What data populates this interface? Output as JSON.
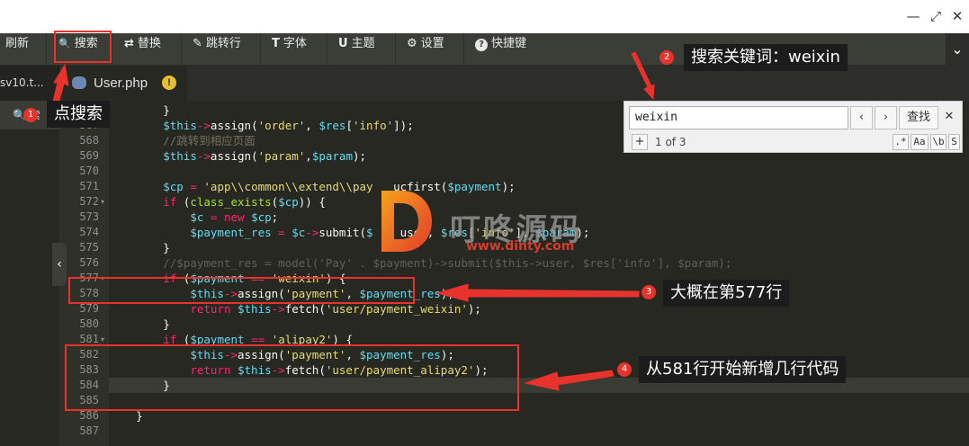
{
  "window": {
    "restore_glyph": "⤢",
    "close_glyph": "✕",
    "minimize_glyph": "—"
  },
  "toolbar": {
    "items": [
      {
        "icon": "refresh-icon",
        "glyph": "",
        "label": "刷新"
      },
      {
        "icon": "search-icon",
        "glyph": "🔍",
        "label": "搜索"
      },
      {
        "icon": "replace-icon",
        "glyph": "⇄",
        "label": "替换"
      },
      {
        "icon": "goto-icon",
        "glyph": "✎",
        "label": "跳转行"
      },
      {
        "icon": "font-icon",
        "glyph": "T",
        "label": "字体"
      },
      {
        "icon": "theme-icon",
        "glyph": "U",
        "label": "主题"
      },
      {
        "icon": "gear-icon",
        "glyph": "⚙",
        "label": "设置"
      },
      {
        "icon": "help-icon",
        "glyph": "?",
        "label": "快捷键"
      }
    ],
    "more_glyph": "⌄"
  },
  "tabs": {
    "left_tab": "sv10.t...",
    "active_tab": "User.php",
    "warn_glyph": "!"
  },
  "sidebar": {
    "search_label": "🔍 索"
  },
  "search_panel": {
    "query": "weixin",
    "prev_glyph": "‹",
    "next_glyph": "›",
    "find_label": "查找",
    "close_glyph": "✕",
    "add_glyph": "+",
    "count": "1 of 3",
    "options": [
      ".*",
      "Aa",
      "\\b",
      "S"
    ]
  },
  "editor": {
    "lines": [
      {
        "num": "",
        "tokens": [
          [
            "v",
            "        }"
          ]
        ]
      },
      {
        "num": "567",
        "tokens": [
          [
            "v",
            "        "
          ],
          [
            "p",
            "$this"
          ],
          [
            "k",
            "->"
          ],
          [
            "v",
            "assign("
          ],
          [
            "s",
            "'order'"
          ],
          [
            "v",
            ", "
          ],
          [
            "p",
            "$res"
          ],
          [
            "v",
            "["
          ],
          [
            "s",
            "'info'"
          ],
          [
            "v",
            "]);"
          ]
        ]
      },
      {
        "num": "568",
        "tokens": [
          [
            "c",
            "        //跳转到相应页面"
          ]
        ]
      },
      {
        "num": "569",
        "tokens": [
          [
            "v",
            "        "
          ],
          [
            "p",
            "$this"
          ],
          [
            "k",
            "->"
          ],
          [
            "v",
            "assign("
          ],
          [
            "s",
            "'param'"
          ],
          [
            "v",
            ","
          ],
          [
            "p",
            "$param"
          ],
          [
            "v",
            ");"
          ]
        ]
      },
      {
        "num": "570",
        "tokens": []
      },
      {
        "num": "571",
        "tokens": [
          [
            "v",
            "        "
          ],
          [
            "p",
            "$cp"
          ],
          [
            "v",
            " "
          ],
          [
            "k",
            "="
          ],
          [
            "v",
            " "
          ],
          [
            "s",
            "'app\\\\common\\\\extend\\\\pay"
          ],
          [
            "v",
            "   ucfirst("
          ],
          [
            "p",
            "$payment"
          ],
          [
            "v",
            ");"
          ]
        ]
      },
      {
        "num": "572",
        "fold": true,
        "tokens": [
          [
            "v",
            "        "
          ],
          [
            "k",
            "if"
          ],
          [
            "v",
            " ("
          ],
          [
            "f",
            "class_exists"
          ],
          [
            "v",
            "("
          ],
          [
            "p",
            "$cp"
          ],
          [
            "v",
            ")) {"
          ]
        ]
      },
      {
        "num": "573",
        "tokens": [
          [
            "v",
            "            "
          ],
          [
            "p",
            "$c"
          ],
          [
            "v",
            " "
          ],
          [
            "k",
            "="
          ],
          [
            "v",
            " "
          ],
          [
            "k",
            "new"
          ],
          [
            "v",
            " "
          ],
          [
            "p",
            "$cp"
          ],
          [
            "v",
            ";"
          ]
        ]
      },
      {
        "num": "574",
        "tokens": [
          [
            "v",
            "            "
          ],
          [
            "p",
            "$payment_res"
          ],
          [
            "v",
            " "
          ],
          [
            "k",
            "="
          ],
          [
            "v",
            " "
          ],
          [
            "p",
            "$c"
          ],
          [
            "k",
            "->"
          ],
          [
            "v",
            "submit("
          ],
          [
            "p",
            "$"
          ],
          [
            "v",
            "    user, "
          ],
          [
            "p",
            "$res"
          ],
          [
            "v",
            "["
          ],
          [
            "s",
            "'info'"
          ],
          [
            "v",
            "], "
          ],
          [
            "p",
            "$param"
          ],
          [
            "v",
            ");"
          ]
        ]
      },
      {
        "num": "575",
        "tokens": [
          [
            "v",
            "        }"
          ]
        ]
      },
      {
        "num": "576",
        "tokens": [
          [
            "dim",
            "        //$payment_res = model('Pay' . $payment)->submit($this->user, $res['info'], $param);"
          ]
        ]
      },
      {
        "num": "577",
        "fold": true,
        "tokens": [
          [
            "v",
            "        "
          ],
          [
            "k",
            "if"
          ],
          [
            "v",
            " ("
          ],
          [
            "p",
            "$payment"
          ],
          [
            "v",
            " "
          ],
          [
            "k",
            "=="
          ],
          [
            "v",
            " "
          ],
          [
            "s",
            "'weixin'"
          ],
          [
            "v",
            ") {"
          ]
        ]
      },
      {
        "num": "578",
        "tokens": [
          [
            "v",
            "            "
          ],
          [
            "p",
            "$this"
          ],
          [
            "k",
            "->"
          ],
          [
            "v",
            "assign("
          ],
          [
            "s",
            "'payment'"
          ],
          [
            "v",
            ", "
          ],
          [
            "p",
            "$payment_res"
          ],
          [
            "v",
            ");"
          ]
        ]
      },
      {
        "num": "579",
        "tokens": [
          [
            "v",
            "            "
          ],
          [
            "k",
            "return"
          ],
          [
            "v",
            " "
          ],
          [
            "p",
            "$this"
          ],
          [
            "k",
            "->"
          ],
          [
            "v",
            "fetch("
          ],
          [
            "s",
            "'user/payment_weixin'"
          ],
          [
            "v",
            ");"
          ]
        ]
      },
      {
        "num": "580",
        "tokens": [
          [
            "v",
            "        }"
          ]
        ]
      },
      {
        "num": "581",
        "fold": true,
        "tokens": [
          [
            "v",
            "        "
          ],
          [
            "k",
            "if"
          ],
          [
            "v",
            " ("
          ],
          [
            "p",
            "$payment"
          ],
          [
            "v",
            " "
          ],
          [
            "k",
            "=="
          ],
          [
            "v",
            " "
          ],
          [
            "s",
            "'alipay2'"
          ],
          [
            "v",
            ") {"
          ]
        ]
      },
      {
        "num": "582",
        "tokens": [
          [
            "v",
            "            "
          ],
          [
            "p",
            "$this"
          ],
          [
            "k",
            "->"
          ],
          [
            "v",
            "assign("
          ],
          [
            "s",
            "'payment'"
          ],
          [
            "v",
            ", "
          ],
          [
            "p",
            "$payment_res"
          ],
          [
            "v",
            ");"
          ]
        ]
      },
      {
        "num": "583",
        "tokens": [
          [
            "v",
            "            "
          ],
          [
            "k",
            "return"
          ],
          [
            "v",
            " "
          ],
          [
            "p",
            "$this"
          ],
          [
            "k",
            "->"
          ],
          [
            "v",
            "fetch("
          ],
          [
            "s",
            "'user/payment_alipay2'"
          ],
          [
            "v",
            ");"
          ]
        ]
      },
      {
        "num": "584",
        "active": true,
        "tokens": [
          [
            "v",
            "        }"
          ]
        ]
      },
      {
        "num": "585",
        "tokens": []
      },
      {
        "num": "586",
        "tokens": [
          [
            "v",
            "    }"
          ]
        ]
      },
      {
        "num": "587",
        "tokens": []
      }
    ]
  },
  "watermark": {
    "brand_cn": "叮咚源码",
    "url": "www.dinty.com"
  },
  "annotations": {
    "step1": {
      "num": "1",
      "text": "点搜索"
    },
    "step2": {
      "num": "2",
      "text": "搜索关键词：weixin"
    },
    "step3": {
      "num": "3",
      "text": "大概在第577行"
    },
    "step4": {
      "num": "4",
      "text": "从581行开始新增几行代码"
    }
  },
  "colors": {
    "accent_red": "#e8322c",
    "editor_bg": "#272822",
    "keyword": "#f92672",
    "string": "#e6db74",
    "variable": "#66d9ef",
    "function": "#a6e22e",
    "comment": "#75715e"
  }
}
